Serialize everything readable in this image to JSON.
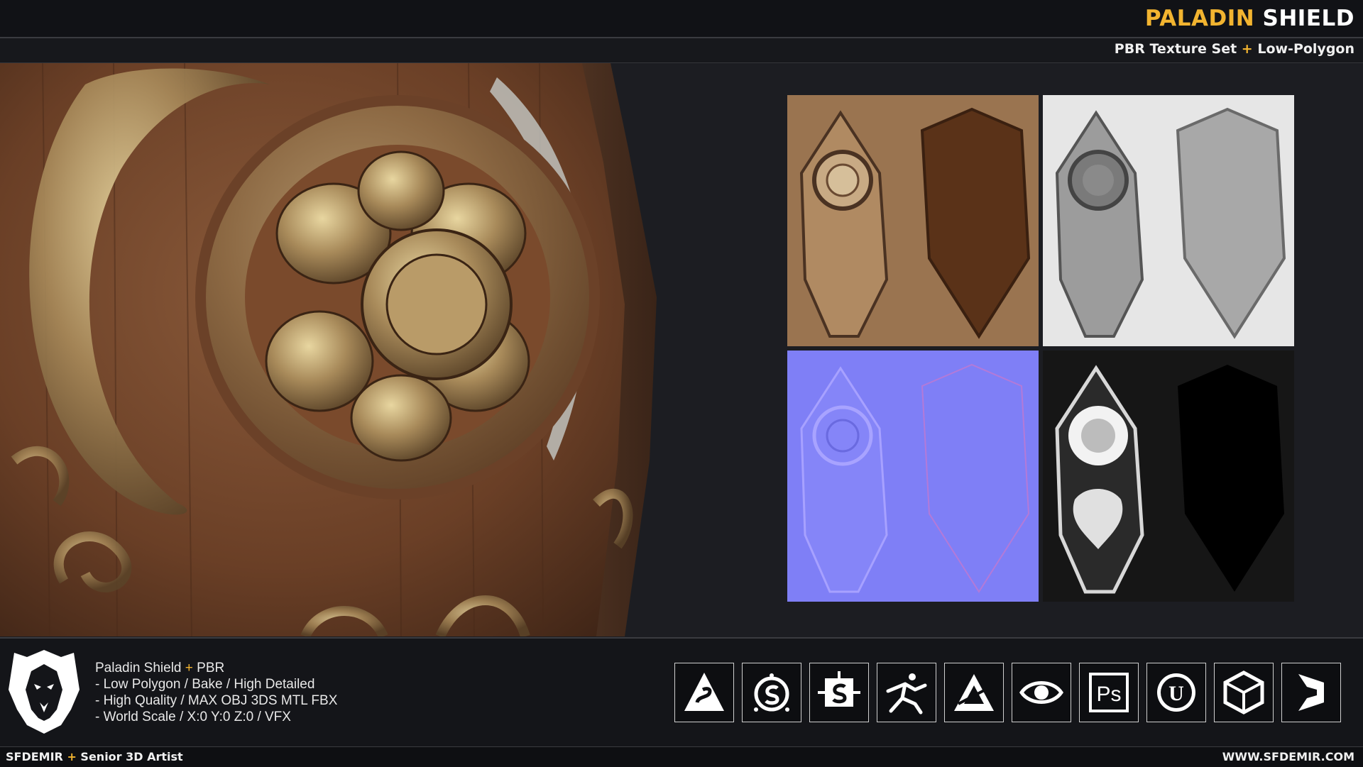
{
  "header": {
    "title_part1": "PALADIN",
    "title_part2": "SHIELD",
    "subtitle_part1": "PBR Texture Set",
    "subtitle_plus": "+",
    "subtitle_part2": "Low-Polygon"
  },
  "info": {
    "name": "Paladin Shield",
    "plus": "+",
    "name_suffix": "PBR",
    "lines": [
      "- Low Polygon / Bake /  High Detailed",
      "- High Quality / MAX OBJ 3DS MTL FBX",
      "- World Scale / X:0 Y:0 Z:0 / VFX"
    ]
  },
  "texture_maps": [
    {
      "icon": "basecolor-map"
    },
    {
      "icon": "roughness-map"
    },
    {
      "icon": "normal-map"
    },
    {
      "icon": "metallic-map"
    }
  ],
  "tools": [
    {
      "icon": "substance-alchemist-icon"
    },
    {
      "icon": "substance-painter-icon"
    },
    {
      "icon": "substance-designer-icon"
    },
    {
      "icon": "zbrush-icon"
    },
    {
      "icon": "affinity-icon"
    },
    {
      "icon": "marmoset-icon",
      "label": ""
    },
    {
      "icon": "photoshop-icon",
      "label": "Ps"
    },
    {
      "icon": "unreal-engine-icon",
      "label": "U"
    },
    {
      "icon": "unity-icon"
    },
    {
      "icon": "3ds-max-icon"
    }
  ],
  "footer": {
    "credit_name": "SFDEMIR",
    "credit_plus": "+",
    "credit_role": "Senior 3D Artist",
    "website": "WWW.SFDEMIR.COM"
  },
  "colors": {
    "accent": "#f2b430",
    "background": "#1c1d22"
  }
}
